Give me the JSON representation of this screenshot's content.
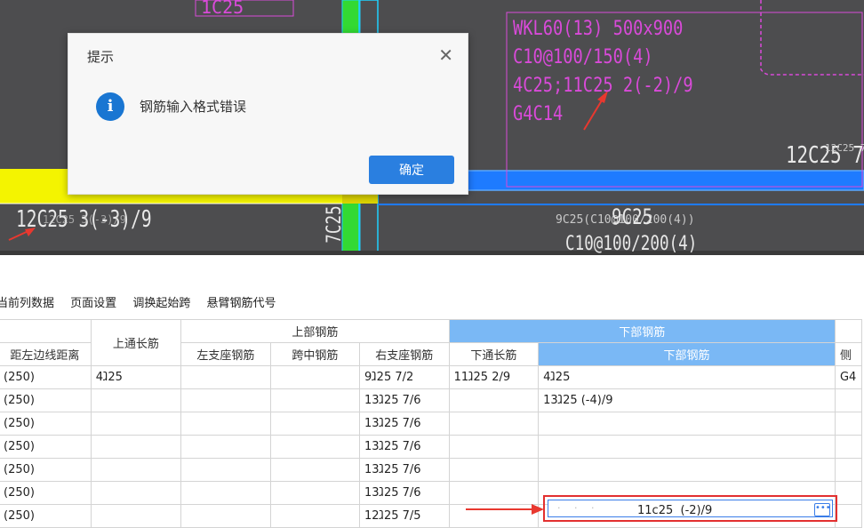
{
  "canvas": {
    "labels": {
      "beam_name": "WKL60(13) 500x900",
      "stirrup": "C10@100/150(4)",
      "top_bottom": "4C25;11C25  2(-2)/9",
      "side": "G4C14",
      "right_label": "12C25 7",
      "right_label_small": "12C25 7/5",
      "left_bottom": "12C25 3(-3)/9",
      "left_bottom_overlay": "12C25 3(-3)/9",
      "column_text": "7C25",
      "mid_small": "9C25(C10@100/200(4))",
      "mid_big": "9C25",
      "mid_stirrup": "C10@100/200(4)",
      "top_fragment": "1C25"
    },
    "colors": {
      "background": "#4d4d4f",
      "column": "#33d933",
      "beam_yellow": "#f4f400",
      "beam_blue": "#1e7bff",
      "annotation": "#d94ad9",
      "arrow": "#e8382f"
    }
  },
  "toolbar": {
    "items": [
      "当前列数据",
      "页面设置",
      "调换起始跨",
      "悬臂钢筋代号"
    ]
  },
  "table": {
    "group_headers": {
      "top": "上部钢筋",
      "bottom_group": "下部钢筋"
    },
    "headers": {
      "left_dist": "距左边线距离",
      "top_through": "上通长筋",
      "left_support": "左支座钢筋",
      "mid_span": "跨中钢筋",
      "right_support": "右支座钢筋",
      "bottom_through": "下通长筋",
      "bottom": "下部钢筋",
      "side": "侧"
    },
    "rows": [
      {
        "dist": "(250)",
        "top_through": "4ⱹ25",
        "left": "",
        "mid": "",
        "right": "9ⱹ25 7/2",
        "bottom_through": "11ⱹ25 2/9",
        "bottom": "4ⱹ25",
        "side": "G4"
      },
      {
        "dist": "(250)",
        "top_through": "",
        "left": "",
        "mid": "",
        "right": "13ⱹ25 7/6",
        "bottom_through": "",
        "bottom": "13ⱹ25 (-4)/9",
        "side": ""
      },
      {
        "dist": "(250)",
        "top_through": "",
        "left": "",
        "mid": "",
        "right": "13ⱹ25 7/6",
        "bottom_through": "",
        "bottom": "",
        "side": ""
      },
      {
        "dist": "(250)",
        "top_through": "",
        "left": "",
        "mid": "",
        "right": "13ⱹ25 7/6",
        "bottom_through": "",
        "bottom": "",
        "side": ""
      },
      {
        "dist": "(250)",
        "top_through": "",
        "left": "",
        "mid": "",
        "right": "13ⱹ25 7/6",
        "bottom_through": "",
        "bottom": "",
        "side": ""
      },
      {
        "dist": "(250)",
        "top_through": "",
        "left": "",
        "mid": "",
        "right": "13ⱹ25 7/6",
        "bottom_through": "",
        "bottom": "",
        "side": ""
      },
      {
        "dist": "(250)",
        "top_through": "",
        "left": "",
        "mid": "",
        "right": "12ⱹ25 7/5",
        "bottom_through": "",
        "bottom": "",
        "side": ""
      }
    ],
    "editing_value": "11c25  (-2)/9",
    "editing_faint": "· · ·"
  },
  "dialog": {
    "title": "提示",
    "message": "钢筋输入格式错误",
    "ok_label": "确定",
    "icon": "info-icon",
    "close_icon": "close-icon"
  }
}
